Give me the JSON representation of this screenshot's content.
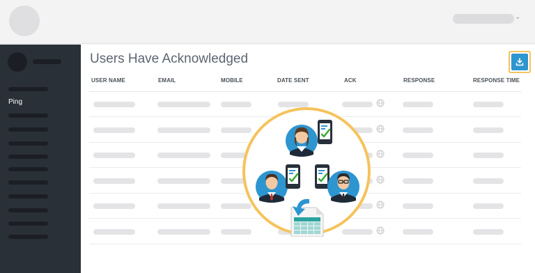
{
  "page": {
    "title": "Users Have Acknowledged"
  },
  "sidebar": {
    "active_item": "Ping"
  },
  "table": {
    "columns": [
      "USER NAME",
      "EMAIL",
      "MOBILE",
      "DATE SENT",
      "ACK",
      "RESPONSE",
      "RESPONSE TIME"
    ],
    "row_count": 6
  },
  "colors": {
    "sidebar": "#2a3038",
    "accent": "#2d95cf",
    "highlight": "#f5c35c",
    "check": "#3aa935"
  },
  "icons": [
    "download-icon",
    "globe-icon",
    "chevron-down-icon"
  ]
}
